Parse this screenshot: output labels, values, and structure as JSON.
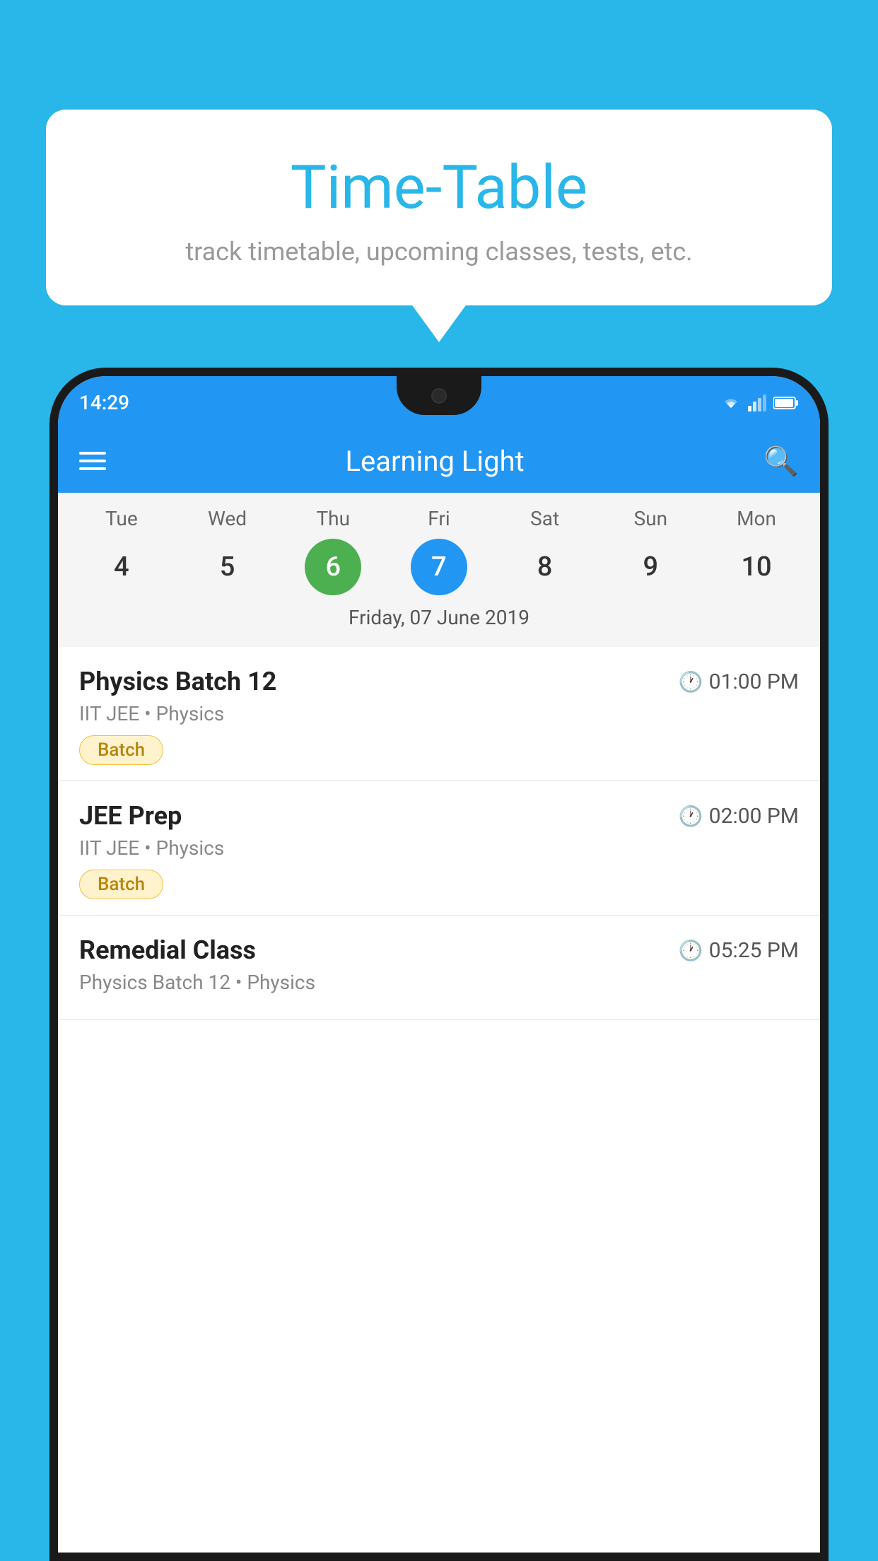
{
  "background_color": "#29B6E8",
  "bubble": {
    "title": "Time-Table",
    "subtitle": "track timetable, upcoming classes, tests, etc."
  },
  "status_bar": {
    "time": "14:29"
  },
  "app_header": {
    "title": "Learning Light"
  },
  "calendar": {
    "days": [
      {
        "label": "Tue",
        "num": "4"
      },
      {
        "label": "Wed",
        "num": "5"
      },
      {
        "label": "Thu",
        "num": "6",
        "state": "today"
      },
      {
        "label": "Fri",
        "num": "7",
        "state": "selected"
      },
      {
        "label": "Sat",
        "num": "8"
      },
      {
        "label": "Sun",
        "num": "9"
      },
      {
        "label": "Mon",
        "num": "10"
      }
    ],
    "selected_date": "Friday, 07 June 2019"
  },
  "classes": [
    {
      "name": "Physics Batch 12",
      "time": "01:00 PM",
      "subject": "IIT JEE • Physics",
      "tag": "Batch"
    },
    {
      "name": "JEE Prep",
      "time": "02:00 PM",
      "subject": "IIT JEE • Physics",
      "tag": "Batch"
    },
    {
      "name": "Remedial Class",
      "time": "05:25 PM",
      "subject": "Physics Batch 12 • Physics",
      "tag": ""
    }
  ]
}
